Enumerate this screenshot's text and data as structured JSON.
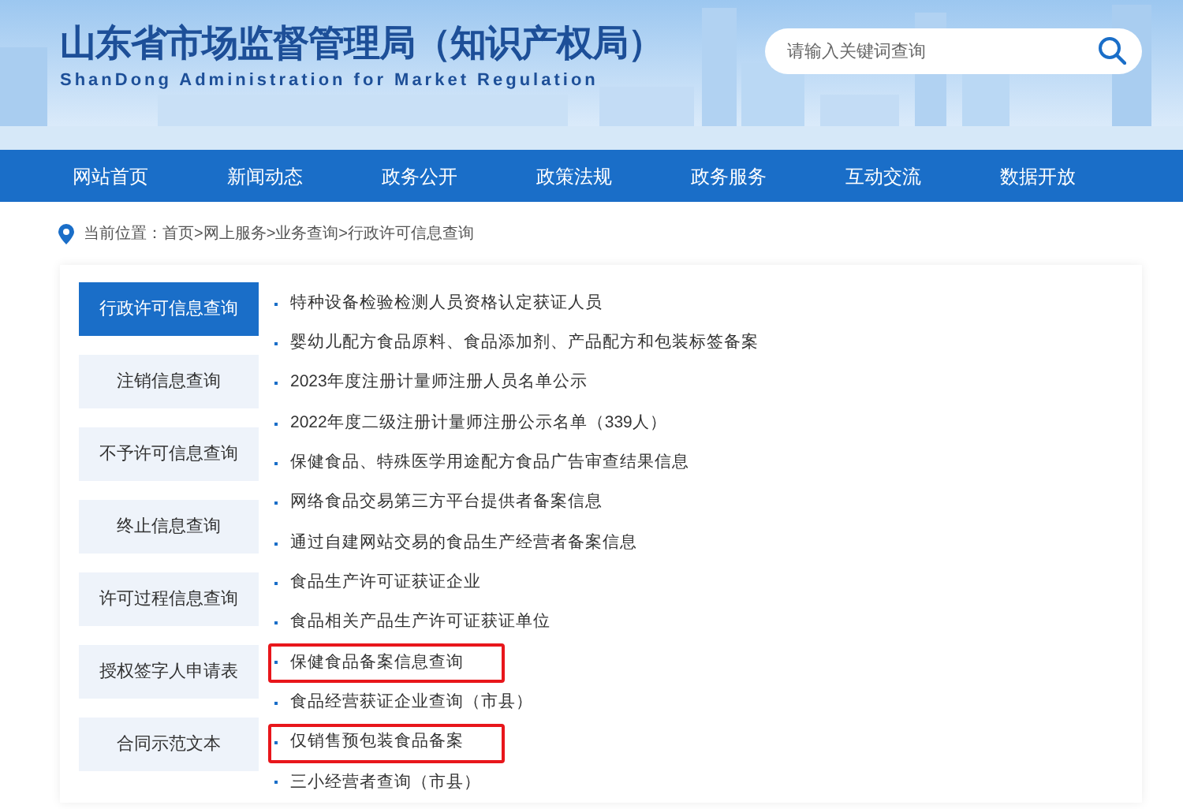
{
  "header": {
    "title": "山东省市场监督管理局（知识产权局）",
    "subtitle": "ShanDong Administration for Market Regulation",
    "search": {
      "placeholder": "请输入关键词查询"
    }
  },
  "nav": [
    {
      "label": "网站首页"
    },
    {
      "label": "新闻动态"
    },
    {
      "label": "政务公开"
    },
    {
      "label": "政策法规"
    },
    {
      "label": "政务服务"
    },
    {
      "label": "互动交流"
    },
    {
      "label": "数据开放"
    }
  ],
  "breadcrumb": "当前位置：首页>网上服务>业务查询>行政许可信息查询",
  "sidebar": [
    {
      "label": "行政许可信息查询",
      "selected": true
    },
    {
      "label": "注销信息查询",
      "selected": false
    },
    {
      "label": "不予许可信息查询",
      "selected": false
    },
    {
      "label": "终止信息查询",
      "selected": false
    },
    {
      "label": "许可过程信息查询",
      "selected": false
    },
    {
      "label": "授权签字人申请表",
      "selected": false
    },
    {
      "label": "合同示范文本",
      "selected": false
    }
  ],
  "items": [
    {
      "label": "特种设备检验检测人员资格认定获证人员",
      "highlighted": false
    },
    {
      "label": "婴幼儿配方食品原料、食品添加剂、产品配方和包装标签备案",
      "highlighted": false
    },
    {
      "label": "2023年度注册计量师注册人员名单公示",
      "highlighted": false
    },
    {
      "label": "2022年度二级注册计量师注册公示名单（339人）",
      "highlighted": false
    },
    {
      "label": "保健食品、特殊医学用途配方食品广告审查结果信息",
      "highlighted": false
    },
    {
      "label": "网络食品交易第三方平台提供者备案信息",
      "highlighted": false
    },
    {
      "label": "通过自建网站交易的食品生产经营者备案信息",
      "highlighted": false
    },
    {
      "label": "食品生产许可证获证企业",
      "highlighted": false
    },
    {
      "label": "食品相关产品生产许可证获证单位",
      "highlighted": false
    },
    {
      "label": "保健食品备案信息查询",
      "highlighted": true
    },
    {
      "label": "食品经营获证企业查询（市县）",
      "highlighted": false
    },
    {
      "label": "仅销售预包装食品备案",
      "highlighted": true
    },
    {
      "label": "三小经营者查询（市县）",
      "highlighted": false
    }
  ]
}
